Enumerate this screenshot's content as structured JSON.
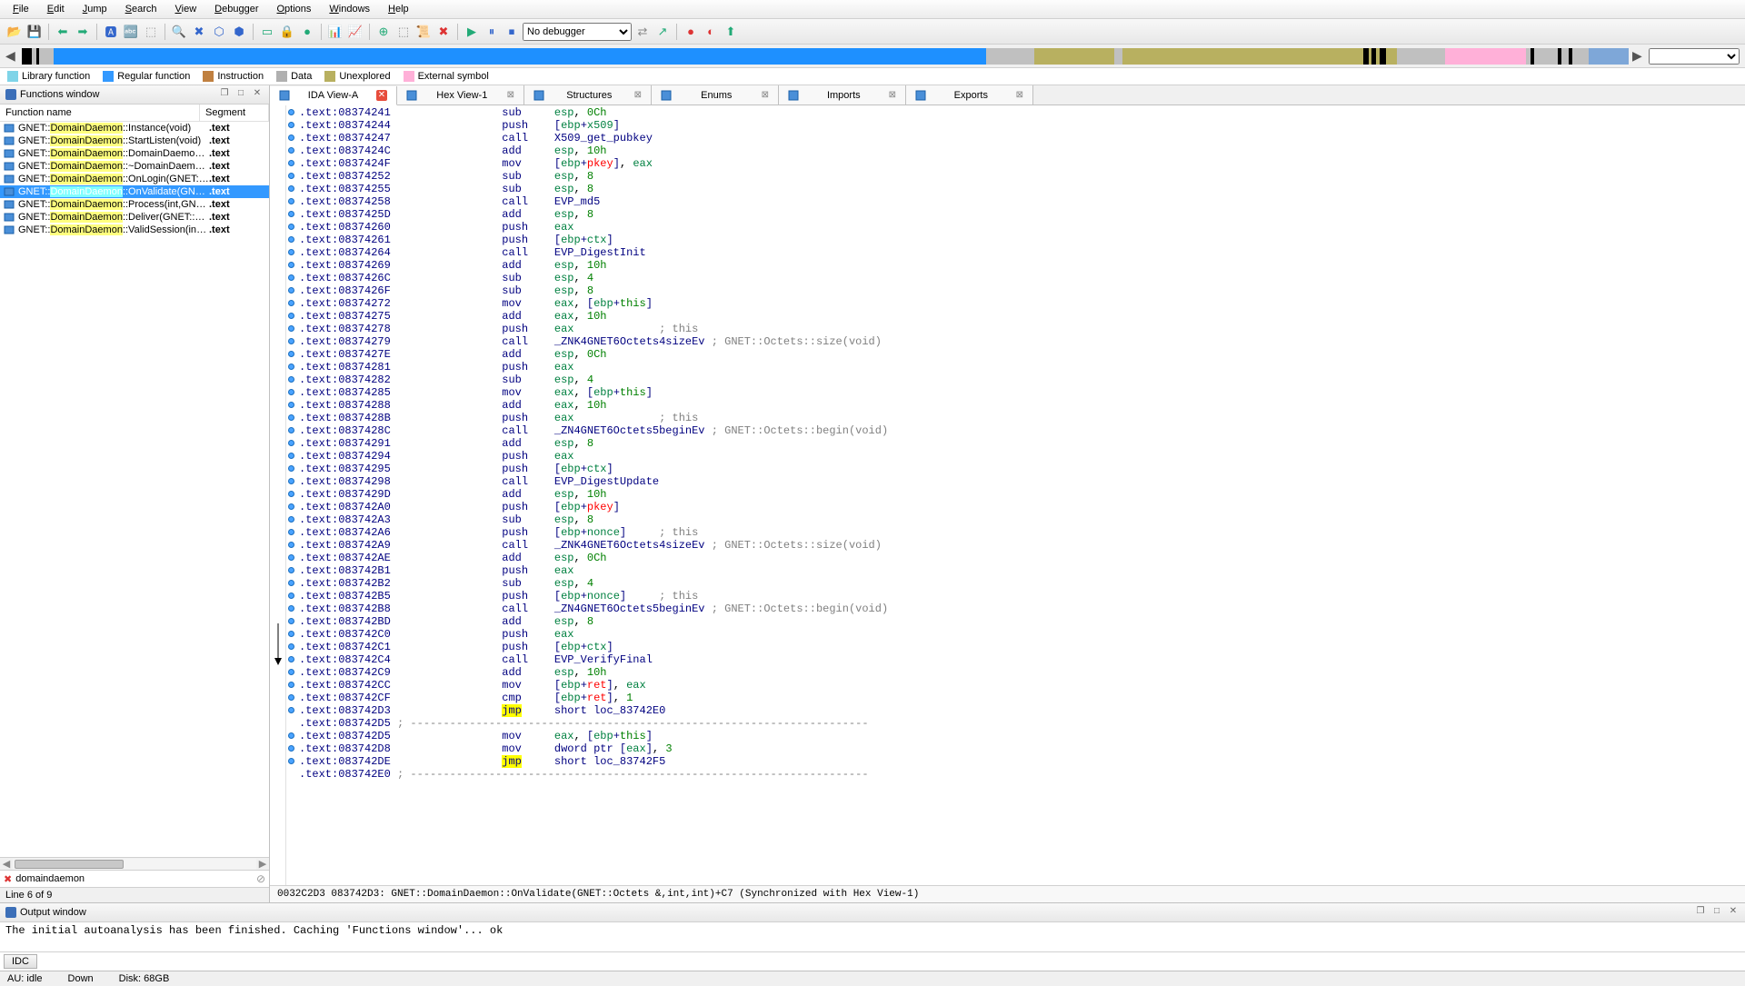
{
  "menu": [
    "File",
    "Edit",
    "Jump",
    "Search",
    "View",
    "Debugger",
    "Options",
    "Windows",
    "Help"
  ],
  "debugger_combo": "No debugger",
  "legend": [
    {
      "label": "Library function",
      "color": "#7fd4e8"
    },
    {
      "label": "Regular function",
      "color": "#3399ff"
    },
    {
      "label": "Instruction",
      "color": "#c08040"
    },
    {
      "label": "Data",
      "color": "#b0b0b0"
    },
    {
      "label": "Unexplored",
      "color": "#b8b060"
    },
    {
      "label": "External symbol",
      "color": "#ffb0d8"
    }
  ],
  "functions_window": {
    "title": "Functions window",
    "col_name": "Function name",
    "col_seg": "Segment",
    "rows": [
      {
        "pre": "GNET::",
        "hl": "DomainDaemon",
        "post": "::Instance(void)",
        "seg": ".text",
        "sel": false
      },
      {
        "pre": "GNET::",
        "hl": "DomainDaemon",
        "post": "::StartListen(void)",
        "seg": ".text",
        "sel": false
      },
      {
        "pre": "GNET::",
        "hl": "DomainDaemon",
        "post": "::DomainDaemon(void)",
        "seg": ".text",
        "sel": false
      },
      {
        "pre": "GNET::",
        "hl": "DomainDaemon",
        "post": "::~DomainDaemon()",
        "seg": ".text",
        "sel": false
      },
      {
        "pre": "GNET::",
        "hl": "DomainDaemon",
        "post": "::OnLogin(GNET::Octets...",
        "seg": ".text",
        "sel": false
      },
      {
        "pre": "GNET::",
        "hl": "DomainDaemon",
        "post": "::OnValidate(GNET::Oct...",
        "seg": ".text",
        "sel": true
      },
      {
        "pre": "GNET::",
        "hl": "DomainDaemon",
        "post": "::Process(int,GNET::Do...",
        "seg": ".text",
        "sel": false
      },
      {
        "pre": "GNET::",
        "hl": "DomainDaemon",
        "post": "::Deliver(GNET::Domain...",
        "seg": ".text",
        "sel": false
      },
      {
        "pre": "GNET::",
        "hl": "DomainDaemon",
        "post": "::ValidSession(int,int)",
        "seg": ".text",
        "sel": false
      }
    ],
    "filter": "domaindaemon",
    "linestat": "Line 6 of 9"
  },
  "tabs": [
    {
      "label": "IDA View-A",
      "active": true
    },
    {
      "label": "Hex View-1",
      "active": false
    },
    {
      "label": "Structures",
      "active": false
    },
    {
      "label": "Enums",
      "active": false
    },
    {
      "label": "Imports",
      "active": false
    },
    {
      "label": "Exports",
      "active": false
    }
  ],
  "disasm": [
    {
      "a": ".text:08374241",
      "m": "sub",
      "ops": [
        {
          "t": "esp",
          "c": "g2"
        },
        {
          "t": ", "
        },
        {
          "t": "0Ch",
          "c": "g"
        }
      ]
    },
    {
      "a": ".text:08374244",
      "m": "push",
      "ops": [
        {
          "t": "[",
          "c": "b"
        },
        {
          "t": "ebp",
          "c": "g2"
        },
        {
          "t": "+",
          "c": "b"
        },
        {
          "t": "x509",
          "c": "g2"
        },
        {
          "t": "]",
          "c": "b"
        }
      ]
    },
    {
      "a": ".text:08374247",
      "m": "call",
      "ops": [
        {
          "t": "X509_get_pubkey",
          "c": "b"
        }
      ]
    },
    {
      "a": ".text:0837424C",
      "m": "add",
      "ops": [
        {
          "t": "esp",
          "c": "g2"
        },
        {
          "t": ", "
        },
        {
          "t": "10h",
          "c": "g"
        }
      ]
    },
    {
      "a": ".text:0837424F",
      "m": "mov",
      "ops": [
        {
          "t": "[",
          "c": "b"
        },
        {
          "t": "ebp",
          "c": "g2"
        },
        {
          "t": "+",
          "c": "b"
        },
        {
          "t": "pkey",
          "c": "r"
        },
        {
          "t": "]",
          "c": "b"
        },
        {
          "t": ", "
        },
        {
          "t": "eax",
          "c": "g2"
        }
      ]
    },
    {
      "a": ".text:08374252",
      "m": "sub",
      "ops": [
        {
          "t": "esp",
          "c": "g2"
        },
        {
          "t": ", "
        },
        {
          "t": "8",
          "c": "g"
        }
      ]
    },
    {
      "a": ".text:08374255",
      "m": "sub",
      "ops": [
        {
          "t": "esp",
          "c": "g2"
        },
        {
          "t": ", "
        },
        {
          "t": "8",
          "c": "g"
        }
      ]
    },
    {
      "a": ".text:08374258",
      "m": "call",
      "ops": [
        {
          "t": "EVP_md5",
          "c": "b"
        }
      ]
    },
    {
      "a": ".text:0837425D",
      "m": "add",
      "ops": [
        {
          "t": "esp",
          "c": "g2"
        },
        {
          "t": ", "
        },
        {
          "t": "8",
          "c": "g"
        }
      ]
    },
    {
      "a": ".text:08374260",
      "m": "push",
      "ops": [
        {
          "t": "eax",
          "c": "g2"
        }
      ]
    },
    {
      "a": ".text:08374261",
      "m": "push",
      "ops": [
        {
          "t": "[",
          "c": "b"
        },
        {
          "t": "ebp",
          "c": "g2"
        },
        {
          "t": "+",
          "c": "b"
        },
        {
          "t": "ctx",
          "c": "g2"
        },
        {
          "t": "]",
          "c": "b"
        }
      ]
    },
    {
      "a": ".text:08374264",
      "m": "call",
      "ops": [
        {
          "t": "EVP_DigestInit",
          "c": "b"
        }
      ]
    },
    {
      "a": ".text:08374269",
      "m": "add",
      "ops": [
        {
          "t": "esp",
          "c": "g2"
        },
        {
          "t": ", "
        },
        {
          "t": "10h",
          "c": "g"
        }
      ]
    },
    {
      "a": ".text:0837426C",
      "m": "sub",
      "ops": [
        {
          "t": "esp",
          "c": "g2"
        },
        {
          "t": ", "
        },
        {
          "t": "4",
          "c": "g"
        }
      ]
    },
    {
      "a": ".text:0837426F",
      "m": "sub",
      "ops": [
        {
          "t": "esp",
          "c": "g2"
        },
        {
          "t": ", "
        },
        {
          "t": "8",
          "c": "g"
        }
      ]
    },
    {
      "a": ".text:08374272",
      "m": "mov",
      "ops": [
        {
          "t": "eax",
          "c": "g2"
        },
        {
          "t": ", "
        },
        {
          "t": "[",
          "c": "b"
        },
        {
          "t": "ebp",
          "c": "g2"
        },
        {
          "t": "+",
          "c": "b"
        },
        {
          "t": "this",
          "c": "g"
        },
        {
          "t": "]",
          "c": "b"
        }
      ]
    },
    {
      "a": ".text:08374275",
      "m": "add",
      "ops": [
        {
          "t": "eax",
          "c": "g2"
        },
        {
          "t": ", "
        },
        {
          "t": "10h",
          "c": "g"
        }
      ]
    },
    {
      "a": ".text:08374278",
      "m": "push",
      "ops": [
        {
          "t": "eax",
          "c": "g2"
        },
        {
          "t": "             "
        },
        {
          "t": "; this",
          "c": "gray"
        }
      ]
    },
    {
      "a": ".text:08374279",
      "m": "call",
      "ops": [
        {
          "t": "_ZNK4GNET6Octets4sizeEv",
          "c": "b"
        },
        {
          "t": " "
        },
        {
          "t": "; GNET::Octets::size(void)",
          "c": "gray"
        }
      ]
    },
    {
      "a": ".text:0837427E",
      "m": "add",
      "ops": [
        {
          "t": "esp",
          "c": "g2"
        },
        {
          "t": ", "
        },
        {
          "t": "0Ch",
          "c": "g"
        }
      ]
    },
    {
      "a": ".text:08374281",
      "m": "push",
      "ops": [
        {
          "t": "eax",
          "c": "g2"
        }
      ]
    },
    {
      "a": ".text:08374282",
      "m": "sub",
      "ops": [
        {
          "t": "esp",
          "c": "g2"
        },
        {
          "t": ", "
        },
        {
          "t": "4",
          "c": "g"
        }
      ]
    },
    {
      "a": ".text:08374285",
      "m": "mov",
      "ops": [
        {
          "t": "eax",
          "c": "g2"
        },
        {
          "t": ", "
        },
        {
          "t": "[",
          "c": "b"
        },
        {
          "t": "ebp",
          "c": "g2"
        },
        {
          "t": "+",
          "c": "b"
        },
        {
          "t": "this",
          "c": "g"
        },
        {
          "t": "]",
          "c": "b"
        }
      ]
    },
    {
      "a": ".text:08374288",
      "m": "add",
      "ops": [
        {
          "t": "eax",
          "c": "g2"
        },
        {
          "t": ", "
        },
        {
          "t": "10h",
          "c": "g"
        }
      ]
    },
    {
      "a": ".text:0837428B",
      "m": "push",
      "ops": [
        {
          "t": "eax",
          "c": "g2"
        },
        {
          "t": "             "
        },
        {
          "t": "; this",
          "c": "gray"
        }
      ]
    },
    {
      "a": ".text:0837428C",
      "m": "call",
      "ops": [
        {
          "t": "_ZN4GNET6Octets5beginEv",
          "c": "b"
        },
        {
          "t": " "
        },
        {
          "t": "; GNET::Octets::begin(void)",
          "c": "gray"
        }
      ]
    },
    {
      "a": ".text:08374291",
      "m": "add",
      "ops": [
        {
          "t": "esp",
          "c": "g2"
        },
        {
          "t": ", "
        },
        {
          "t": "8",
          "c": "g"
        }
      ]
    },
    {
      "a": ".text:08374294",
      "m": "push",
      "ops": [
        {
          "t": "eax",
          "c": "g2"
        }
      ]
    },
    {
      "a": ".text:08374295",
      "m": "push",
      "ops": [
        {
          "t": "[",
          "c": "b"
        },
        {
          "t": "ebp",
          "c": "g2"
        },
        {
          "t": "+",
          "c": "b"
        },
        {
          "t": "ctx",
          "c": "g2"
        },
        {
          "t": "]",
          "c": "b"
        }
      ]
    },
    {
      "a": ".text:08374298",
      "m": "call",
      "ops": [
        {
          "t": "EVP_DigestUpdate",
          "c": "b"
        }
      ]
    },
    {
      "a": ".text:0837429D",
      "m": "add",
      "ops": [
        {
          "t": "esp",
          "c": "g2"
        },
        {
          "t": ", "
        },
        {
          "t": "10h",
          "c": "g"
        }
      ]
    },
    {
      "a": ".text:083742A0",
      "m": "push",
      "ops": [
        {
          "t": "[",
          "c": "b"
        },
        {
          "t": "ebp",
          "c": "g2"
        },
        {
          "t": "+",
          "c": "b"
        },
        {
          "t": "pkey",
          "c": "r"
        },
        {
          "t": "]",
          "c": "b"
        }
      ]
    },
    {
      "a": ".text:083742A3",
      "m": "sub",
      "ops": [
        {
          "t": "esp",
          "c": "g2"
        },
        {
          "t": ", "
        },
        {
          "t": "8",
          "c": "g"
        }
      ]
    },
    {
      "a": ".text:083742A6",
      "m": "push",
      "ops": [
        {
          "t": "[",
          "c": "b"
        },
        {
          "t": "ebp",
          "c": "g2"
        },
        {
          "t": "+",
          "c": "b"
        },
        {
          "t": "nonce",
          "c": "g2"
        },
        {
          "t": "]",
          "c": "b"
        },
        {
          "t": "     "
        },
        {
          "t": "; this",
          "c": "gray"
        }
      ]
    },
    {
      "a": ".text:083742A9",
      "m": "call",
      "ops": [
        {
          "t": "_ZNK4GNET6Octets4sizeEv",
          "c": "b"
        },
        {
          "t": " "
        },
        {
          "t": "; GNET::Octets::size(void)",
          "c": "gray"
        }
      ]
    },
    {
      "a": ".text:083742AE",
      "m": "add",
      "ops": [
        {
          "t": "esp",
          "c": "g2"
        },
        {
          "t": ", "
        },
        {
          "t": "0Ch",
          "c": "g"
        }
      ]
    },
    {
      "a": ".text:083742B1",
      "m": "push",
      "ops": [
        {
          "t": "eax",
          "c": "g2"
        }
      ]
    },
    {
      "a": ".text:083742B2",
      "m": "sub",
      "ops": [
        {
          "t": "esp",
          "c": "g2"
        },
        {
          "t": ", "
        },
        {
          "t": "4",
          "c": "g"
        }
      ]
    },
    {
      "a": ".text:083742B5",
      "m": "push",
      "ops": [
        {
          "t": "[",
          "c": "b"
        },
        {
          "t": "ebp",
          "c": "g2"
        },
        {
          "t": "+",
          "c": "b"
        },
        {
          "t": "nonce",
          "c": "g2"
        },
        {
          "t": "]",
          "c": "b"
        },
        {
          "t": "     "
        },
        {
          "t": "; this",
          "c": "gray"
        }
      ]
    },
    {
      "a": ".text:083742B8",
      "m": "call",
      "ops": [
        {
          "t": "_ZN4GNET6Octets5beginEv",
          "c": "b"
        },
        {
          "t": " "
        },
        {
          "t": "; GNET::Octets::begin(void)",
          "c": "gray"
        }
      ]
    },
    {
      "a": ".text:083742BD",
      "m": "add",
      "ops": [
        {
          "t": "esp",
          "c": "g2"
        },
        {
          "t": ", "
        },
        {
          "t": "8",
          "c": "g"
        }
      ]
    },
    {
      "a": ".text:083742C0",
      "m": "push",
      "ops": [
        {
          "t": "eax",
          "c": "g2"
        }
      ]
    },
    {
      "a": ".text:083742C1",
      "m": "push",
      "ops": [
        {
          "t": "[",
          "c": "b"
        },
        {
          "t": "ebp",
          "c": "g2"
        },
        {
          "t": "+",
          "c": "b"
        },
        {
          "t": "ctx",
          "c": "g2"
        },
        {
          "t": "]",
          "c": "b"
        }
      ]
    },
    {
      "a": ".text:083742C4",
      "m": "call",
      "ops": [
        {
          "t": "EVP_VerifyFinal",
          "c": "b"
        }
      ]
    },
    {
      "a": ".text:083742C9",
      "m": "add",
      "ops": [
        {
          "t": "esp",
          "c": "g2"
        },
        {
          "t": ", "
        },
        {
          "t": "10h",
          "c": "g"
        }
      ]
    },
    {
      "a": ".text:083742CC",
      "m": "mov",
      "ops": [
        {
          "t": "[",
          "c": "b"
        },
        {
          "t": "ebp",
          "c": "g2"
        },
        {
          "t": "+",
          "c": "b"
        },
        {
          "t": "ret",
          "c": "r"
        },
        {
          "t": "]",
          "c": "b"
        },
        {
          "t": ", "
        },
        {
          "t": "eax",
          "c": "g2"
        }
      ]
    },
    {
      "a": ".text:083742CF",
      "m": "cmp",
      "ops": [
        {
          "t": "[",
          "c": "b"
        },
        {
          "t": "ebp",
          "c": "g2"
        },
        {
          "t": "+",
          "c": "b"
        },
        {
          "t": "ret",
          "c": "r"
        },
        {
          "t": "]",
          "c": "b"
        },
        {
          "t": ", "
        },
        {
          "t": "1",
          "c": "g"
        }
      ]
    },
    {
      "a": ".text:083742D3",
      "m": "jmp",
      "jmp": true,
      "ops": [
        {
          "t": "short loc_83742E0",
          "c": "b"
        }
      ]
    },
    {
      "a": ".text:083742D5",
      "dash": true
    },
    {
      "a": ".text:083742D5",
      "m": "mov",
      "ops": [
        {
          "t": "eax",
          "c": "g2"
        },
        {
          "t": ", "
        },
        {
          "t": "[",
          "c": "b"
        },
        {
          "t": "ebp",
          "c": "g2"
        },
        {
          "t": "+",
          "c": "b"
        },
        {
          "t": "this",
          "c": "g"
        },
        {
          "t": "]",
          "c": "b"
        }
      ]
    },
    {
      "a": ".text:083742D8",
      "m": "mov",
      "ops": [
        {
          "t": "dword ptr ",
          "c": "b"
        },
        {
          "t": "[",
          "c": "b"
        },
        {
          "t": "eax",
          "c": "g2"
        },
        {
          "t": "]",
          "c": "b"
        },
        {
          "t": ", "
        },
        {
          "t": "3",
          "c": "g"
        }
      ]
    },
    {
      "a": ".text:083742DE",
      "m": "jmp",
      "jmp": true,
      "ops": [
        {
          "t": "short loc_83742F5",
          "c": "b"
        }
      ]
    },
    {
      "a": ".text:083742E0",
      "dash": true
    }
  ],
  "status_info": "0032C2D3  083742D3: GNET::DomainDaemon::OnValidate(GNET::Octets &,int,int)+C7  (Synchronized with Hex View-1)",
  "output": {
    "title": "Output window",
    "lines": [
      "The initial autoanalysis has been finished.",
      "Caching 'Functions window'... ok"
    ],
    "idc_label": "IDC"
  },
  "statusbar": {
    "au": "AU:  idle",
    "down": "Down",
    "disk": "Disk: 68GB"
  },
  "navsegs": [
    {
      "w": "0.6%",
      "c": "#000"
    },
    {
      "w": "0.3%",
      "c": "#c0c0c0"
    },
    {
      "w": "0.2%",
      "c": "#000"
    },
    {
      "w": "0.9%",
      "c": "#c0c0c0"
    },
    {
      "w": "58%",
      "c": "#1e90ff"
    },
    {
      "w": "3%",
      "c": "#c0c0c0"
    },
    {
      "w": "5%",
      "c": "#b8b060"
    },
    {
      "w": "0.5%",
      "c": "#c0c0c0"
    },
    {
      "w": "15%",
      "c": "#b8b060"
    },
    {
      "w": "0.3%",
      "c": "#000"
    },
    {
      "w": "0.2%",
      "c": "#b8b060"
    },
    {
      "w": "0.3%",
      "c": "#000"
    },
    {
      "w": "0.2%",
      "c": "#b8b060"
    },
    {
      "w": "0.4%",
      "c": "#000"
    },
    {
      "w": "0.7%",
      "c": "#b8b060"
    },
    {
      "w": "3%",
      "c": "#c0c0c0"
    },
    {
      "w": "5%",
      "c": "#ffb0d8"
    },
    {
      "w": "0.3%",
      "c": "#c0c0c0"
    },
    {
      "w": "0.2%",
      "c": "#000"
    },
    {
      "w": "1.5%",
      "c": "#c0c0c0"
    },
    {
      "w": "0.2%",
      "c": "#000"
    },
    {
      "w": "0.5%",
      "c": "#c0c0c0"
    },
    {
      "w": "0.2%",
      "c": "#000"
    },
    {
      "w": "1%",
      "c": "#c0c0c0"
    }
  ]
}
